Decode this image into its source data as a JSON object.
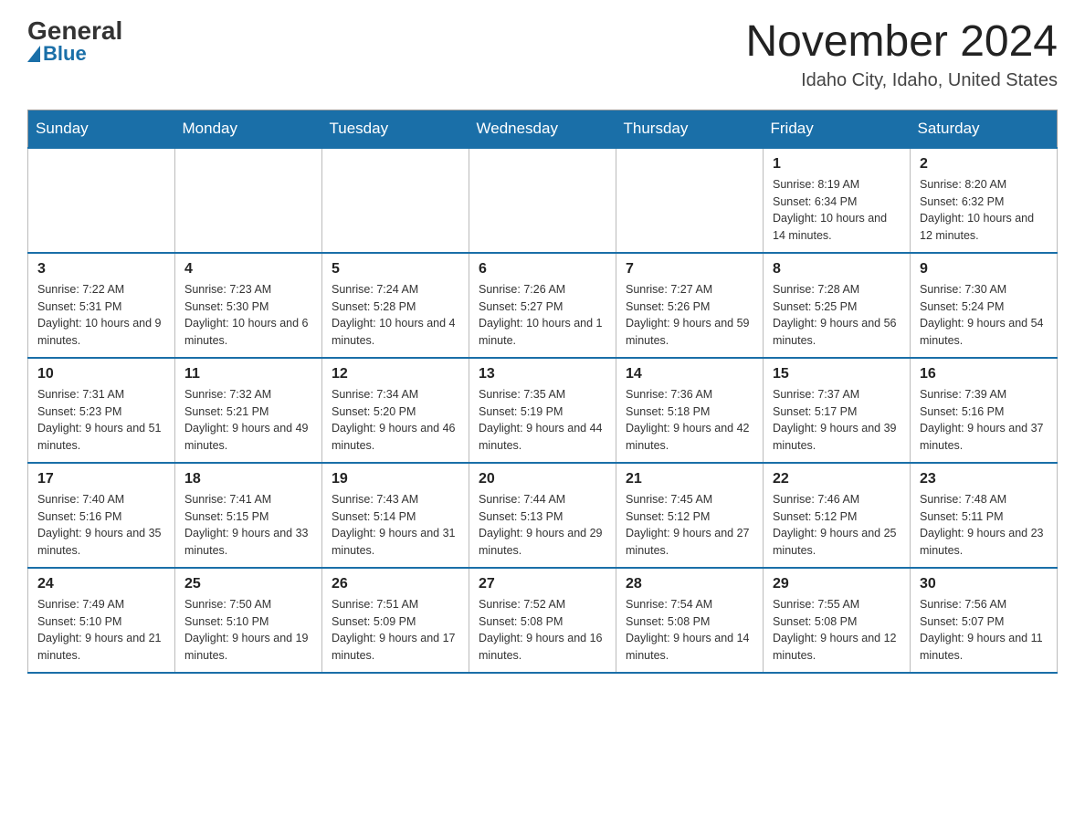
{
  "header": {
    "logo_general": "General",
    "logo_blue": "Blue",
    "month_title": "November 2024",
    "location": "Idaho City, Idaho, United States"
  },
  "days_of_week": [
    "Sunday",
    "Monday",
    "Tuesday",
    "Wednesday",
    "Thursday",
    "Friday",
    "Saturday"
  ],
  "weeks": [
    [
      {
        "day": "",
        "info": ""
      },
      {
        "day": "",
        "info": ""
      },
      {
        "day": "",
        "info": ""
      },
      {
        "day": "",
        "info": ""
      },
      {
        "day": "",
        "info": ""
      },
      {
        "day": "1",
        "info": "Sunrise: 8:19 AM\nSunset: 6:34 PM\nDaylight: 10 hours and 14 minutes."
      },
      {
        "day": "2",
        "info": "Sunrise: 8:20 AM\nSunset: 6:32 PM\nDaylight: 10 hours and 12 minutes."
      }
    ],
    [
      {
        "day": "3",
        "info": "Sunrise: 7:22 AM\nSunset: 5:31 PM\nDaylight: 10 hours and 9 minutes."
      },
      {
        "day": "4",
        "info": "Sunrise: 7:23 AM\nSunset: 5:30 PM\nDaylight: 10 hours and 6 minutes."
      },
      {
        "day": "5",
        "info": "Sunrise: 7:24 AM\nSunset: 5:28 PM\nDaylight: 10 hours and 4 minutes."
      },
      {
        "day": "6",
        "info": "Sunrise: 7:26 AM\nSunset: 5:27 PM\nDaylight: 10 hours and 1 minute."
      },
      {
        "day": "7",
        "info": "Sunrise: 7:27 AM\nSunset: 5:26 PM\nDaylight: 9 hours and 59 minutes."
      },
      {
        "day": "8",
        "info": "Sunrise: 7:28 AM\nSunset: 5:25 PM\nDaylight: 9 hours and 56 minutes."
      },
      {
        "day": "9",
        "info": "Sunrise: 7:30 AM\nSunset: 5:24 PM\nDaylight: 9 hours and 54 minutes."
      }
    ],
    [
      {
        "day": "10",
        "info": "Sunrise: 7:31 AM\nSunset: 5:23 PM\nDaylight: 9 hours and 51 minutes."
      },
      {
        "day": "11",
        "info": "Sunrise: 7:32 AM\nSunset: 5:21 PM\nDaylight: 9 hours and 49 minutes."
      },
      {
        "day": "12",
        "info": "Sunrise: 7:34 AM\nSunset: 5:20 PM\nDaylight: 9 hours and 46 minutes."
      },
      {
        "day": "13",
        "info": "Sunrise: 7:35 AM\nSunset: 5:19 PM\nDaylight: 9 hours and 44 minutes."
      },
      {
        "day": "14",
        "info": "Sunrise: 7:36 AM\nSunset: 5:18 PM\nDaylight: 9 hours and 42 minutes."
      },
      {
        "day": "15",
        "info": "Sunrise: 7:37 AM\nSunset: 5:17 PM\nDaylight: 9 hours and 39 minutes."
      },
      {
        "day": "16",
        "info": "Sunrise: 7:39 AM\nSunset: 5:16 PM\nDaylight: 9 hours and 37 minutes."
      }
    ],
    [
      {
        "day": "17",
        "info": "Sunrise: 7:40 AM\nSunset: 5:16 PM\nDaylight: 9 hours and 35 minutes."
      },
      {
        "day": "18",
        "info": "Sunrise: 7:41 AM\nSunset: 5:15 PM\nDaylight: 9 hours and 33 minutes."
      },
      {
        "day": "19",
        "info": "Sunrise: 7:43 AM\nSunset: 5:14 PM\nDaylight: 9 hours and 31 minutes."
      },
      {
        "day": "20",
        "info": "Sunrise: 7:44 AM\nSunset: 5:13 PM\nDaylight: 9 hours and 29 minutes."
      },
      {
        "day": "21",
        "info": "Sunrise: 7:45 AM\nSunset: 5:12 PM\nDaylight: 9 hours and 27 minutes."
      },
      {
        "day": "22",
        "info": "Sunrise: 7:46 AM\nSunset: 5:12 PM\nDaylight: 9 hours and 25 minutes."
      },
      {
        "day": "23",
        "info": "Sunrise: 7:48 AM\nSunset: 5:11 PM\nDaylight: 9 hours and 23 minutes."
      }
    ],
    [
      {
        "day": "24",
        "info": "Sunrise: 7:49 AM\nSunset: 5:10 PM\nDaylight: 9 hours and 21 minutes."
      },
      {
        "day": "25",
        "info": "Sunrise: 7:50 AM\nSunset: 5:10 PM\nDaylight: 9 hours and 19 minutes."
      },
      {
        "day": "26",
        "info": "Sunrise: 7:51 AM\nSunset: 5:09 PM\nDaylight: 9 hours and 17 minutes."
      },
      {
        "day": "27",
        "info": "Sunrise: 7:52 AM\nSunset: 5:08 PM\nDaylight: 9 hours and 16 minutes."
      },
      {
        "day": "28",
        "info": "Sunrise: 7:54 AM\nSunset: 5:08 PM\nDaylight: 9 hours and 14 minutes."
      },
      {
        "day": "29",
        "info": "Sunrise: 7:55 AM\nSunset: 5:08 PM\nDaylight: 9 hours and 12 minutes."
      },
      {
        "day": "30",
        "info": "Sunrise: 7:56 AM\nSunset: 5:07 PM\nDaylight: 9 hours and 11 minutes."
      }
    ]
  ]
}
